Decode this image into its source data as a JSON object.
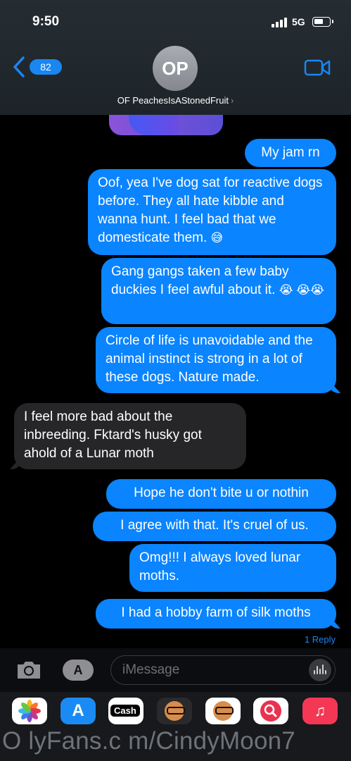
{
  "status_bar": {
    "time": "9:50",
    "network": "5G"
  },
  "header": {
    "back_count": "82",
    "avatar_initials": "OP",
    "contact_name": "OF PeachesIsAStonedFruit",
    "contact_chevron": "›"
  },
  "messages": [
    {
      "from": "me",
      "text": "My jam rn"
    },
    {
      "from": "me",
      "text": "Oof, yea I've dog sat for reactive dogs before. They all hate kibble and wanna hunt. I feel bad that we domesticate them.",
      "emoji": "😅"
    },
    {
      "from": "me",
      "text": "Gang gangs taken a few baby duckies I feel awful about it.",
      "emoji": "😭 😭😭"
    },
    {
      "from": "me",
      "text": "Circle of life is unavoidable and the animal instinct is strong in a lot of these dogs. Nature made."
    },
    {
      "from": "them",
      "text": "I feel more bad about the inbreeding. Fktard's husky got ahold of a Lunar moth"
    },
    {
      "from": "me",
      "text": "Hope he don't bite u or nothin"
    },
    {
      "from": "me",
      "text": "I agree with that. It's cruel of us."
    },
    {
      "from": "me",
      "text": "Omg!!! I always loved lunar moths."
    },
    {
      "from": "me",
      "text": "I had a hobby farm of silk moths"
    }
  ],
  "reply_label": "1 Reply",
  "input": {
    "placeholder": "iMessage"
  },
  "app_drawer": {
    "apps": [
      "photos-icon",
      "app-store-icon",
      "cash-app-icon",
      "memoji-icon",
      "memoji-stickers-icon",
      "web-search-icon",
      "music-icon"
    ],
    "cash_label": "Cash"
  },
  "watermark": "O lyFans.c m/CindyMoon7",
  "colors": {
    "sent_bubble": "#0a84ff",
    "received_bubble": "#262628",
    "accent": "#1a86f2"
  }
}
